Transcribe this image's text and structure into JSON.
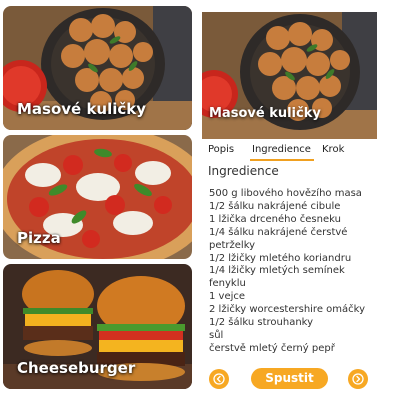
{
  "recipes": [
    {
      "title": "Masové kuličky"
    },
    {
      "title": "Pizza"
    },
    {
      "title": "Cheeseburger"
    }
  ],
  "detail": {
    "title": "Masové kuličky",
    "tabs": [
      {
        "label": "Popis"
      },
      {
        "label": "Ingredience",
        "active": true
      },
      {
        "label": "Krok"
      }
    ],
    "section_heading": "Ingredience",
    "ingredients": [
      "500 g libového hovězího masa",
      "1/2 šálku nakrájené cibule",
      "1 lžička drceného česneku",
      "1/4 šálku nakrájené čerstvé",
      "petrželky",
      "1/2 lžičky mletého koriandru",
      "1/4 lžičky mletých semínek",
      "fenyklu",
      "1 vejce",
      "2 lžičky worcestershire omáčky",
      "1/2 šálku strouhanky",
      "sůl",
      "čerstvě mletý černý pepř"
    ],
    "buttons": {
      "start_label": "Spustit",
      "prev_icon": "chevron-left-icon",
      "next_icon": "chevron-right-icon"
    }
  },
  "colors": {
    "accent": "#f7a823",
    "tab_underline": "#f0a020"
  }
}
